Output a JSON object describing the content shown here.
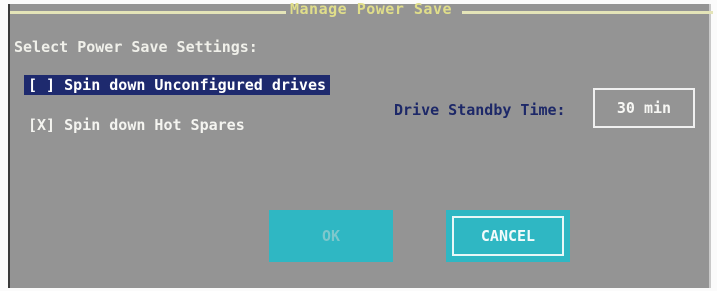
{
  "dialog": {
    "title": "Manage Power Save",
    "heading": "Select Power Save Settings:"
  },
  "options": [
    {
      "label": "[ ] Spin down Unconfigured drives",
      "checked": false,
      "focused": true
    },
    {
      "label": "[X] Spin down Hot Spares",
      "checked": true,
      "focused": false
    }
  ],
  "standby": {
    "label": "Drive Standby Time:",
    "value": "30 min"
  },
  "buttons": {
    "ok_label": "OK",
    "cancel_label": "CANCEL"
  },
  "colors": {
    "panel_bg": "#949494",
    "selection_bg": "#1e2a6e",
    "button_bg": "#2fb7c3",
    "title_color": "#e0de8a",
    "standby_label_color": "#1d2868"
  }
}
